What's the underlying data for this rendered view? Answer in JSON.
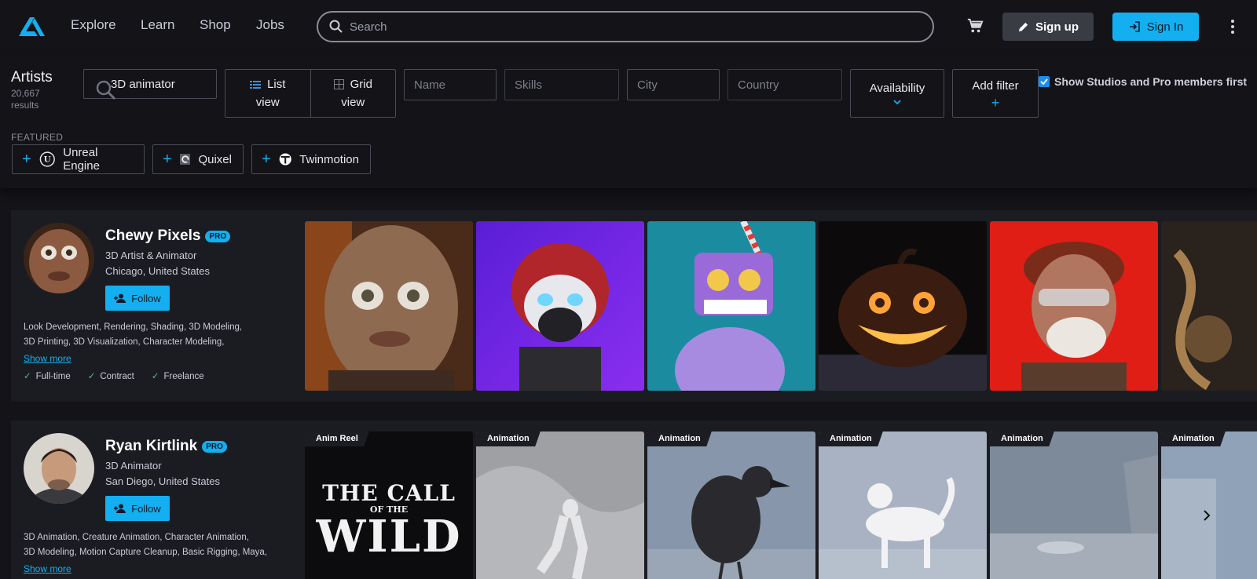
{
  "nav": {
    "links": [
      "Explore",
      "Learn",
      "Shop",
      "Jobs"
    ],
    "search_placeholder": "Search",
    "signup_label": "Sign up",
    "signin_label": "Sign In"
  },
  "filters": {
    "title": "Artists",
    "count": "20,667",
    "count_suffix": "results",
    "query": "3D animator",
    "list_view_top": "List",
    "list_view_bottom": "view",
    "grid_view_top": "Grid",
    "grid_view_bottom": "view",
    "name_placeholder": "Name",
    "skills_placeholder": "Skills",
    "city_placeholder": "City",
    "country_placeholder": "Country",
    "availability_label": "Availability",
    "add_filter_label": "Add filter",
    "studios_checkbox_label": "Show Studios and Pro members first",
    "studios_checked": true,
    "featured_label": "FEATURED",
    "featured": [
      "Unreal Engine",
      "Quixel",
      "Twinmotion"
    ]
  },
  "artists": [
    {
      "name": "Chewy Pixels",
      "badge": "PRO",
      "role": "3D Artist & Animator",
      "location": "Chicago, United States",
      "follow_label": "Follow",
      "skills_line1": "Look Development, Rendering, Shading, 3D Modeling,",
      "skills_line2": "3D Printing, 3D Visualization, Character Modeling,",
      "show_more": "Show more",
      "availability": [
        "Full-time",
        "Contract",
        "Freelance"
      ]
    },
    {
      "name": "Ryan Kirtlink",
      "badge": "PRO",
      "role": "3D Animator",
      "location": "San Diego, United States",
      "follow_label": "Follow",
      "skills_line1": "3D Animation, Creature Animation, Character Animation,",
      "skills_line2": "3D Modeling, Motion Capture Cleanup, Basic Rigging, Maya,",
      "show_more": "Show more",
      "thumb_tags": [
        "Anim Reel",
        "Animation",
        "Animation",
        "Animation",
        "Animation",
        "Animation"
      ],
      "reel_title_line1": "THE CALL",
      "reel_title_line2": "OF THE",
      "reel_title_line3": "WILD"
    }
  ],
  "colors": {
    "accent": "#13aff0",
    "background": "#131318",
    "card": "#1b1c22"
  }
}
